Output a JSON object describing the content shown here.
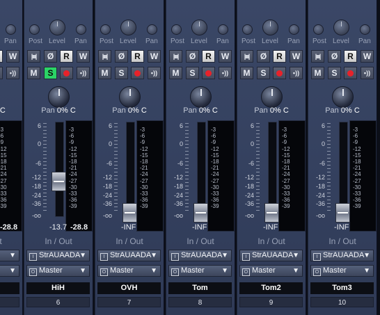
{
  "sends": {
    "post_label": "Post",
    "level_label": "Level",
    "pan_label": "Pan"
  },
  "buttons": {
    "w": "W",
    "r": "R",
    "m": "M",
    "s": "S",
    "phase": "Ø"
  },
  "pan": {
    "prefix": "Pan",
    "value": "0% C"
  },
  "fader_scale": [
    "6",
    "0",
    "-6",
    "-12",
    "-18",
    "-24",
    "-36",
    "-oo"
  ],
  "meter_scale": [
    "-3",
    "-6",
    "-9",
    "-12",
    "-15",
    "-18",
    "-21",
    "-24",
    "-27",
    "-30",
    "-33",
    "-36",
    "-39"
  ],
  "io": {
    "label": "In / Out",
    "output": "Master",
    "input_icon": "I",
    "output_icon": "O"
  },
  "colors": {
    "solo_active": "#2bd466",
    "record": "#e8222a",
    "strip_bg": "#34405e"
  },
  "strips": [
    {
      "name": "",
      "number": "",
      "input": "",
      "fader_db": "-13.7",
      "peak": "-28.8",
      "fader_pos": 0.0,
      "solo": false,
      "partial": true
    },
    {
      "name": "HiH",
      "number": "6",
      "input": "StrAUAADA",
      "fader_db": "-13.7",
      "peak": "-28.8",
      "fader_pos": 0.4,
      "solo": true
    },
    {
      "name": "OVH",
      "number": "7",
      "input": "StrAUAADA",
      "fader_db": "-INF",
      "peak": "",
      "fader_pos": 0.0,
      "solo": false
    },
    {
      "name": "Tom",
      "number": "8",
      "input": "StrAUAADA",
      "fader_db": "-INF",
      "peak": "",
      "fader_pos": 0.0,
      "solo": false
    },
    {
      "name": "Tom2",
      "number": "9",
      "input": "StrAUAADA",
      "fader_db": "-INF",
      "peak": "",
      "fader_pos": 0.0,
      "solo": false
    },
    {
      "name": "Tom3",
      "number": "10",
      "input": "StrAUAADA",
      "fader_db": "-INF",
      "peak": "",
      "fader_pos": 0.0,
      "solo": false
    }
  ]
}
